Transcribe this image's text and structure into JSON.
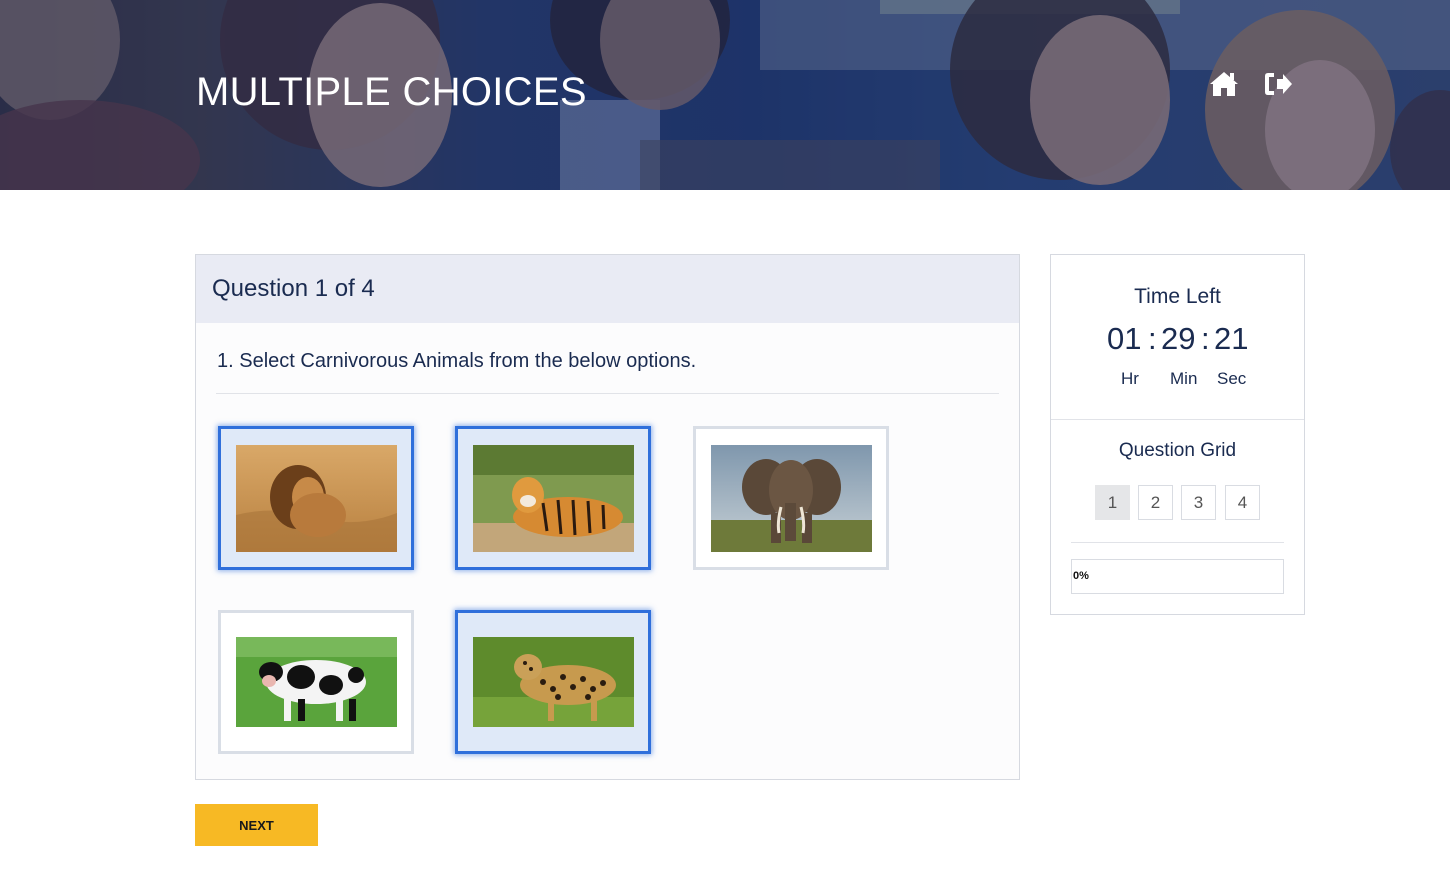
{
  "header": {
    "title": "MULTIPLE CHOICES",
    "icons": [
      "home-icon",
      "sign-out-icon"
    ]
  },
  "question": {
    "header": "Question 1 of 4",
    "text": "1. Select Carnivorous Animals from the below options.",
    "options": [
      {
        "animal": "lion",
        "selected": true
      },
      {
        "animal": "tiger",
        "selected": true
      },
      {
        "animal": "elephant",
        "selected": false
      },
      {
        "animal": "cow",
        "selected": false
      },
      {
        "animal": "leopard",
        "selected": true
      }
    ]
  },
  "next_button": "NEXT",
  "timer": {
    "title": "Time Left",
    "hours": "01",
    "minutes": "29",
    "seconds": "21",
    "separator": ":",
    "hours_label": "Hr",
    "minutes_label": "Min",
    "seconds_label": "Sec"
  },
  "question_grid": {
    "title": "Question Grid",
    "items": [
      "1",
      "2",
      "3",
      "4"
    ],
    "active": "1"
  },
  "progress": {
    "label": "0%",
    "value": 0
  },
  "colors": {
    "accent": "#2f6fdb",
    "button": "#f7b924",
    "text": "#1a2b50"
  }
}
